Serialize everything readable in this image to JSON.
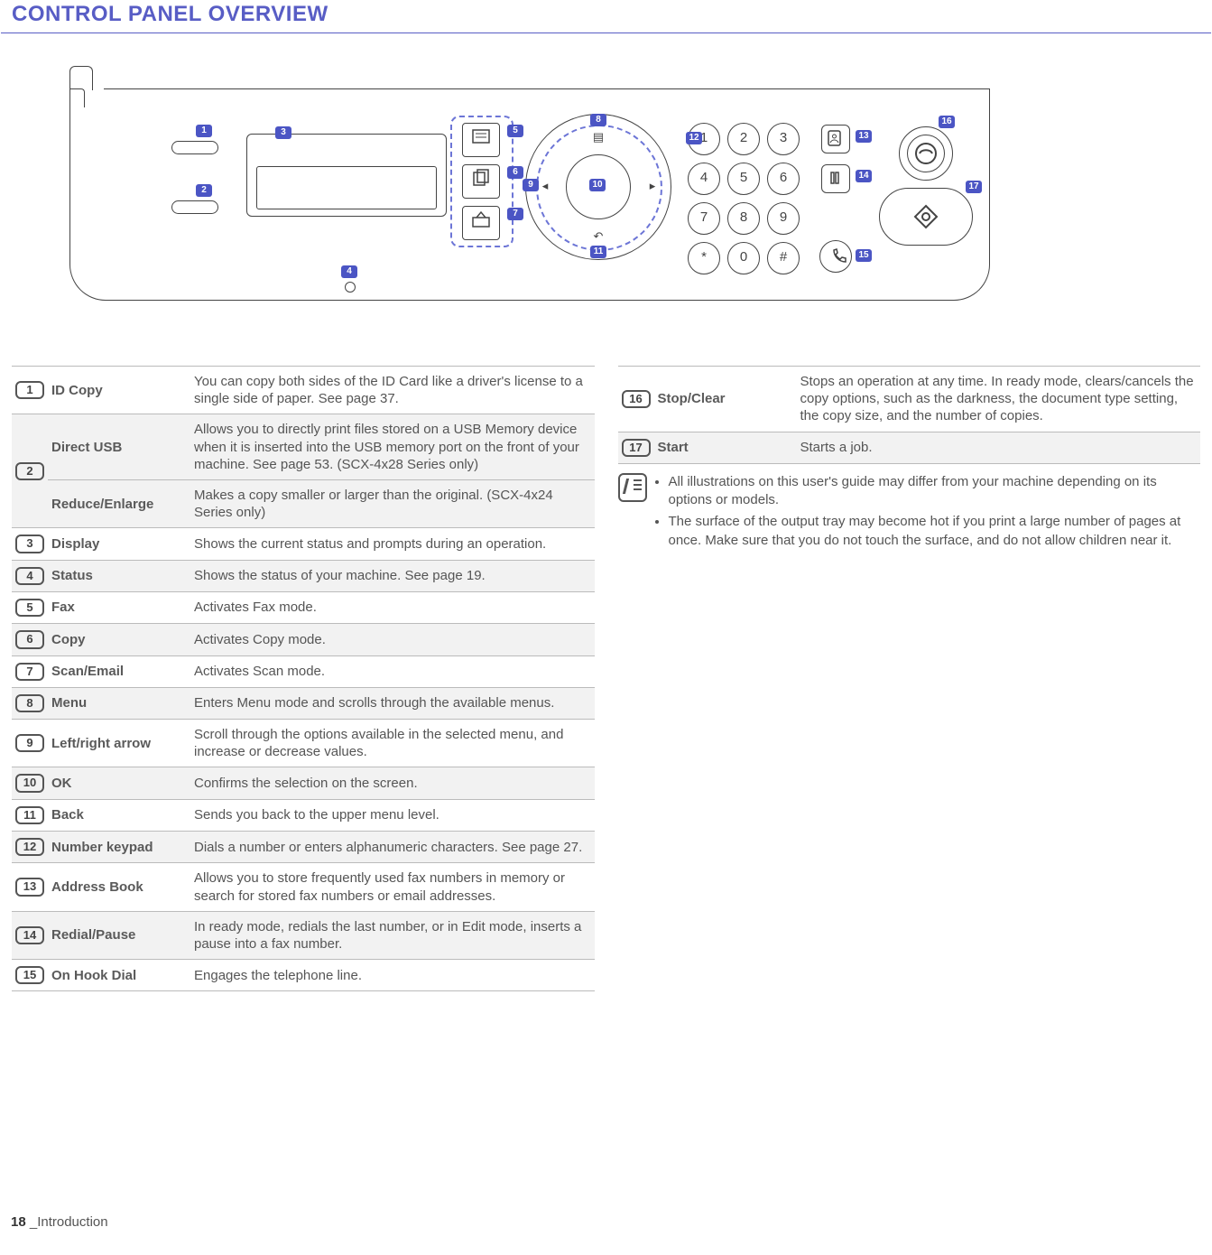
{
  "heading": "CONTROL PANEL OVERVIEW",
  "callouts": [
    "1",
    "2",
    "3",
    "4",
    "5",
    "6",
    "7",
    "8",
    "9",
    "10",
    "11",
    "12",
    "13",
    "14",
    "15",
    "16",
    "17"
  ],
  "keypad": [
    "1",
    "2",
    "3",
    "4",
    "5",
    "6",
    "7",
    "8",
    "9",
    "*",
    "0",
    "#"
  ],
  "ok_label": "OK",
  "left_table": [
    {
      "num": "1",
      "label": "ID Copy",
      "desc": "You can copy both sides of the ID Card like a driver's license to a single side of paper. See page 37.",
      "alt": false
    },
    {
      "num": "2",
      "label": "Direct USB",
      "desc": "Allows you to directly print files stored on a USB Memory device when it is inserted into the USB memory port on the front of your machine. See page 53. (SCX-4x28 Series only)",
      "alt": true,
      "rowspan": 2
    },
    {
      "num": "",
      "label": "Reduce/Enlarge",
      "desc": "Makes a copy smaller or larger than the original. (SCX-4x24 Series only)",
      "alt": true,
      "sub": true
    },
    {
      "num": "3",
      "label": "Display",
      "desc": "Shows the current status and prompts during an operation.",
      "alt": false
    },
    {
      "num": "4",
      "label": "Status",
      "desc": "Shows the status of your machine. See page 19.",
      "alt": true
    },
    {
      "num": "5",
      "label": "Fax",
      "desc": "Activates Fax mode.",
      "alt": false
    },
    {
      "num": "6",
      "label": "Copy",
      "desc": "Activates Copy mode.",
      "alt": true
    },
    {
      "num": "7",
      "label": "Scan/Email",
      "desc": "Activates Scan mode.",
      "alt": false
    },
    {
      "num": "8",
      "label": "Menu",
      "desc": "Enters Menu mode and scrolls through the available menus.",
      "alt": true
    },
    {
      "num": "9",
      "label": "Left/right arrow",
      "desc": "Scroll through the options available in the selected menu, and increase or decrease values.",
      "alt": false
    },
    {
      "num": "10",
      "label": "OK",
      "desc": "Confirms the selection on the screen.",
      "alt": true
    },
    {
      "num": "11",
      "label": "Back",
      "desc": "Sends you back to the upper menu level.",
      "alt": false
    },
    {
      "num": "12",
      "label": "Number keypad",
      "desc": "Dials a number or enters alphanumeric characters. See page 27.",
      "alt": true
    },
    {
      "num": "13",
      "label": "Address Book",
      "desc": "Allows you to store frequently used fax numbers in memory or search for stored fax numbers or email addresses.",
      "alt": false
    },
    {
      "num": "14",
      "label": "Redial/Pause",
      "desc": "In ready mode, redials the last number, or in Edit mode, inserts a pause into a fax number.",
      "alt": true
    },
    {
      "num": "15",
      "label": "On Hook Dial",
      "desc": "Engages the telephone line.",
      "alt": false
    }
  ],
  "right_table": [
    {
      "num": "16",
      "label": "Stop/Clear",
      "desc": "Stops an operation at any time. In ready mode, clears/cancels the copy options, such as the darkness, the document type setting, the copy size, and the number of copies.",
      "alt": false
    },
    {
      "num": "17",
      "label": "Start",
      "desc": "Starts a job.",
      "alt": true
    }
  ],
  "notes": [
    "All illustrations on this user's guide may differ from your machine depending on its options or models.",
    "The surface of the output tray may become hot if you print a large number of pages at once. Make sure that you do not touch the surface, and do not allow children near it."
  ],
  "footer_page": "18",
  "footer_section": "_Introduction"
}
